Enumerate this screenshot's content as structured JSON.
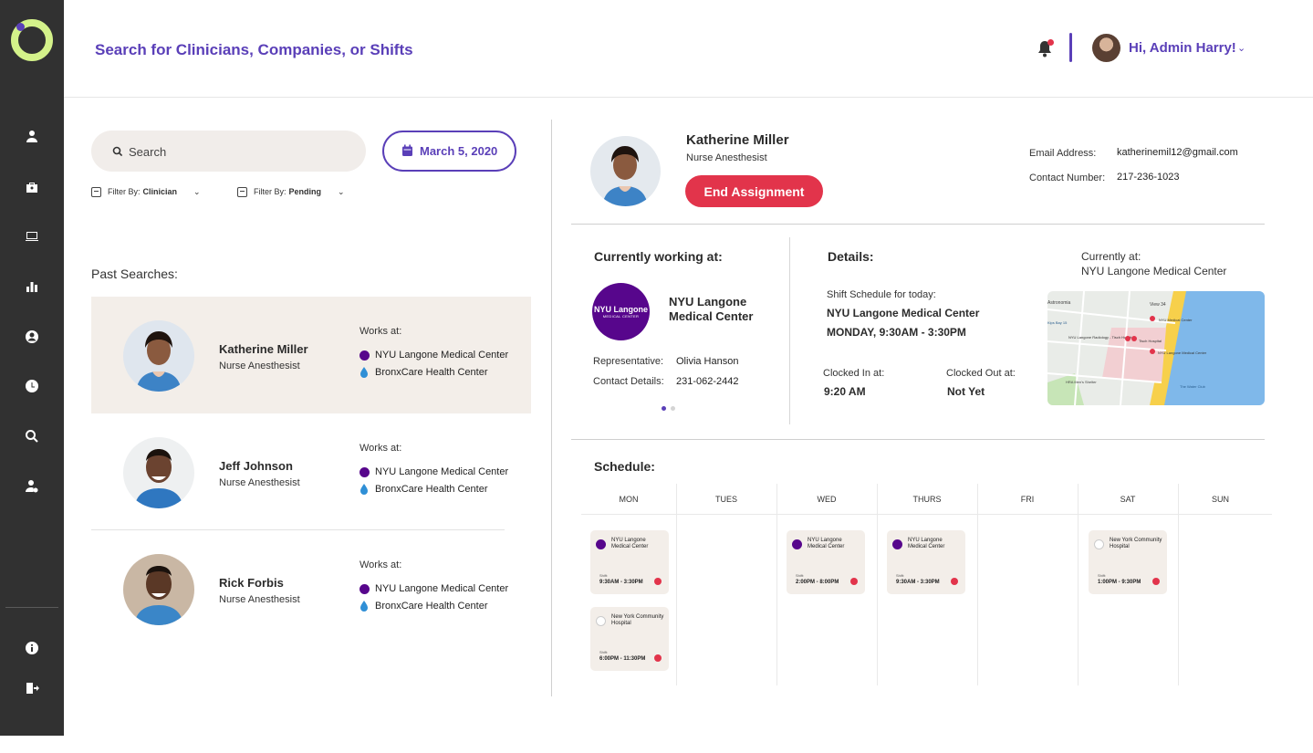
{
  "header": {
    "title": "Search for Clinicians, Companies, or Shifts",
    "greeting": "Hi, Admin Harry!"
  },
  "sidebar": {
    "icons": [
      "clinician-icon",
      "briefcase-icon",
      "monitor-icon",
      "bar-chart-icon",
      "user-circle-icon",
      "clock-icon",
      "search-icon",
      "user-settings-icon"
    ],
    "bottom_icons": [
      "info-icon",
      "logout-icon"
    ]
  },
  "search": {
    "placeholder": "Search",
    "date": "March 5, 2020",
    "filter_clinician_label": "Filter By:",
    "filter_clinician_value": "Clinician",
    "filter_status_label": "Filter By:",
    "filter_status_value": "Pending"
  },
  "past_searches": {
    "title": "Past Searches:",
    "items": [
      {
        "name": "Katherine Miller",
        "role": "Nurse Anesthesist",
        "works_label": "Works at:",
        "locations": [
          "NYU Langone Medical Center",
          "BronxCare Health Center"
        ]
      },
      {
        "name": "Jeff Johnson",
        "role": "Nurse Anesthesist",
        "works_label": "Works at:",
        "locations": [
          "NYU Langone Medical Center",
          "BronxCare Health Center"
        ]
      },
      {
        "name": "Rick Forbis",
        "role": "Nurse Anesthesist",
        "works_label": "Works at:",
        "locations": [
          "NYU Langone Medical Center",
          "BronxCare Health Center"
        ]
      }
    ]
  },
  "detail": {
    "name": "Katherine Miller",
    "role": "Nurse Anesthesist",
    "end_button": "End Assignment",
    "email_label": "Email Address:",
    "email": "katherinemil12@gmail.com",
    "phone_label": "Contact Number:",
    "phone": "217-236-1023",
    "working_title": "Currently working at:",
    "facility_logo_text": "NYU Langone",
    "facility_logo_sub": "MEDICAL CENTER",
    "facility_name": "NYU Langone Medical Center",
    "rep_label": "Representative:",
    "rep_value": "Olivia Hanson",
    "contact_label": "Contact Details:",
    "contact_value": "231-062-2442",
    "details_title": "Details:",
    "currently_at_label": "Currently at:",
    "currently_at_value": "NYU Langone Medical Center",
    "shift_today_label": "Shift Schedule for today:",
    "shift_today_place": "NYU Langone Medical Center",
    "shift_today_time": "MONDAY, 9:30AM - 3:30PM",
    "clocked_in_label": "Clocked In at:",
    "clocked_in_value": "9:20 AM",
    "clocked_out_label": "Clocked Out at:",
    "clocked_out_value": "Not Yet",
    "map_labels": [
      "Astronomia",
      "View 34",
      "NYU Medical Center",
      "NYU Langone Radiology - Tisch Hospital",
      "Tisch Hospital",
      "NYU Langone Medical Center",
      "HRA Men's Shelter",
      "The Water Club",
      "Kips Bay 15"
    ]
  },
  "schedule": {
    "title": "Schedule:",
    "days": [
      "MON",
      "TUES",
      "WED",
      "THURS",
      "FRI",
      "SAT",
      "SUN"
    ],
    "shifts": [
      {
        "name": "NYU Langone Medical Center",
        "label": "Shift:",
        "time": "9:30AM - 3:30PM"
      },
      {
        "name": "New York Community Hospital",
        "label": "Shift:",
        "time": "6:00PM - 11:30PM"
      },
      {
        "name": "NYU Langone Medical Center",
        "label": "Shift:",
        "time": "2:00PM - 8:00PM"
      },
      {
        "name": "NYU Langone Medical Center",
        "label": "Shift:",
        "time": "9:30AM - 3:30PM"
      },
      {
        "name": "New York Community Hospital",
        "label": "Shift:",
        "time": "1:00PM - 9:30PM"
      }
    ]
  },
  "colors": {
    "accent": "#5a3fb8",
    "danger": "#e2344b",
    "sidebar": "#313131",
    "card_bg": "#f3eee9",
    "nyu_purple": "#57068c",
    "logo_green": "#d4f28a"
  }
}
